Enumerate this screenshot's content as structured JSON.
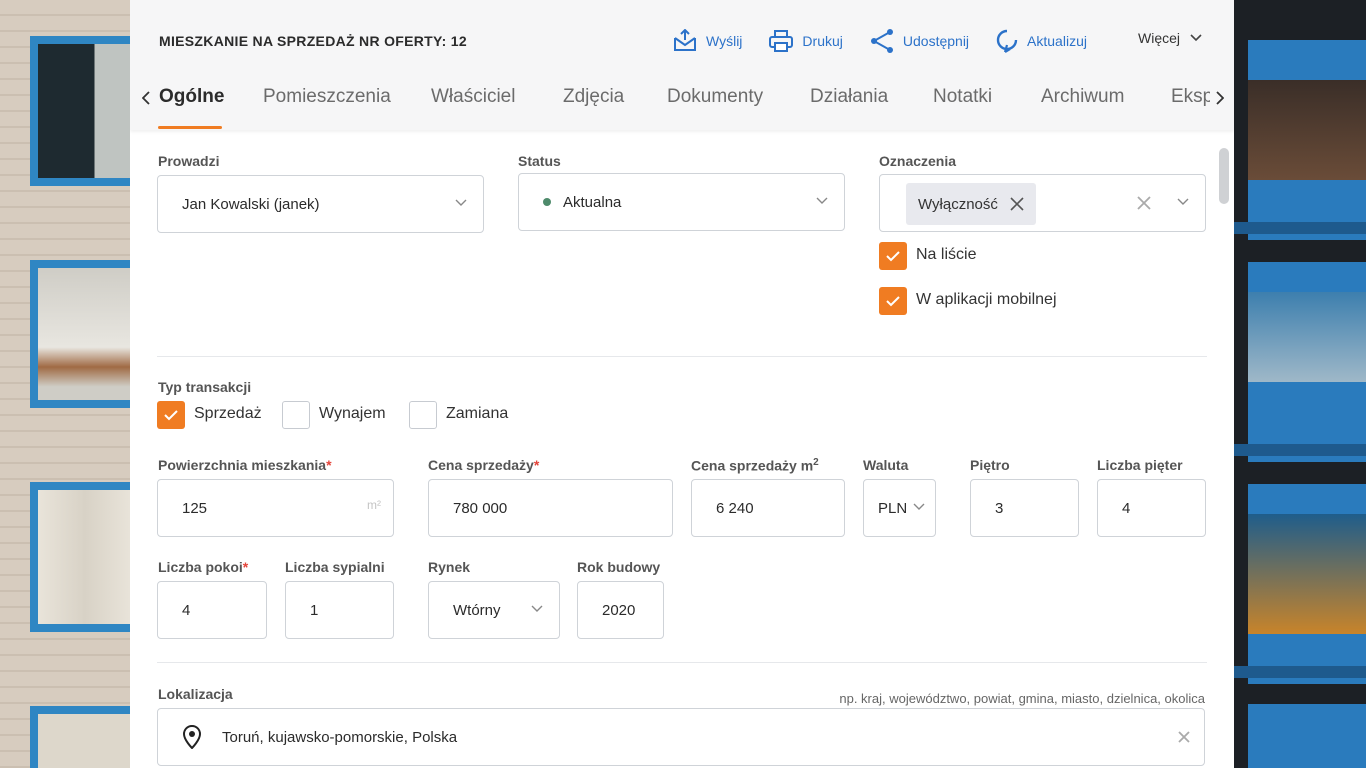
{
  "header": {
    "title": "MIESZKANIE NA SPRZEDAŻ NR OFERTY: 12",
    "actions": [
      {
        "label": "Wyślij",
        "icon": "send-mail-icon"
      },
      {
        "label": "Drukuj",
        "icon": "print-icon"
      },
      {
        "label": "Udostępnij",
        "icon": "share-icon"
      },
      {
        "label": "Aktualizuj",
        "icon": "refresh-icon"
      }
    ],
    "more_label": "Więcej",
    "accent_color": "#2c72c9"
  },
  "tabs": {
    "items": [
      "Ogólne",
      "Pomieszczenia",
      "Właściciel",
      "Zdjęcia",
      "Dokumenty",
      "Działania",
      "Notatki",
      "Archiwum",
      "Eksp"
    ],
    "active_index": 0,
    "active_color": "#f07c22"
  },
  "form": {
    "prowadzi": {
      "label": "Prowadzi",
      "value": "Jan Kowalski (janek)"
    },
    "status": {
      "label": "Status",
      "value": "Aktualna",
      "dot_color": "#4e8a6b"
    },
    "oznaczenia": {
      "label": "Oznaczenia",
      "chip": "Wyłączność"
    },
    "flags": [
      {
        "label": "Na liście",
        "checked": true
      },
      {
        "label": "W aplikacji mobilnej",
        "checked": true
      }
    ],
    "typ_transakcji": {
      "label": "Typ transakcji",
      "options": [
        {
          "label": "Sprzedaż",
          "checked": true
        },
        {
          "label": "Wynajem",
          "checked": false
        },
        {
          "label": "Zamiana",
          "checked": false
        }
      ]
    },
    "powierzchnia": {
      "label": "Powierzchnia mieszkania",
      "required": "*",
      "value": "125",
      "unit": "m²"
    },
    "cena": {
      "label": "Cena sprzedaży",
      "required": "*",
      "value": "780 000"
    },
    "cena_m2": {
      "label": "Cena sprzedaży m",
      "sup": "2",
      "value": "6 240"
    },
    "waluta": {
      "label": "Waluta",
      "value": "PLN"
    },
    "pietro": {
      "label": "Piętro",
      "value": "3"
    },
    "liczba_pieter": {
      "label": "Liczba pięter",
      "value": "4"
    },
    "liczba_pokoi": {
      "label": "Liczba pokoi",
      "required": "*",
      "value": "4"
    },
    "liczba_sypialni": {
      "label": "Liczba sypialni",
      "value": "1"
    },
    "rynek": {
      "label": "Rynek",
      "value": "Wtórny"
    },
    "rok_budowy": {
      "label": "Rok budowy",
      "value": "2020"
    },
    "lokalizacja": {
      "label": "Lokalizacja",
      "hint": "np. kraj, województwo, powiat, gmina, miasto, dzielnica, okolica",
      "value": "Toruń, kujawsko-pomorskie, Polska"
    }
  }
}
